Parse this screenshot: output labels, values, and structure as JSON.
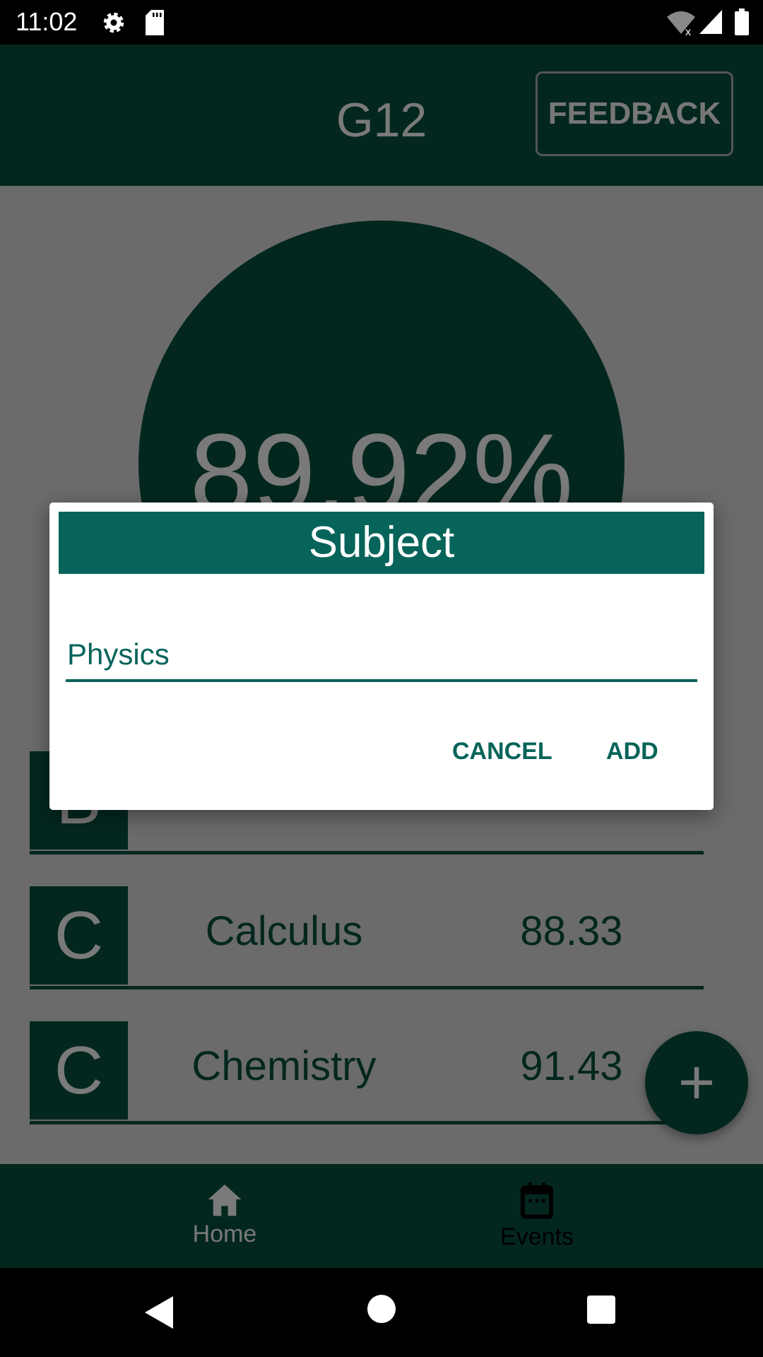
{
  "status_bar": {
    "time": "11:02",
    "icons": [
      "settings-icon",
      "sd-card-icon",
      "wifi-off-icon",
      "signal-icon",
      "battery-icon"
    ]
  },
  "app_bar": {
    "title": "G12",
    "feedback_label": "FEEDBACK"
  },
  "overall": {
    "percent": "89.92%"
  },
  "subjects": [
    {
      "grade": "B"
    },
    {
      "grade": "C",
      "name": "Calculus",
      "score": "88.33"
    },
    {
      "grade": "C",
      "name": "Chemistry",
      "score": "91.43"
    }
  ],
  "fab": {
    "icon": "plus-icon",
    "label": "+"
  },
  "bottom_nav": {
    "items": [
      {
        "label": "Home",
        "icon": "home-icon"
      },
      {
        "label": "Events",
        "icon": "calendar-icon"
      }
    ]
  },
  "dialog": {
    "title": "Subject",
    "input_value": "Physics",
    "cancel_label": "CANCEL",
    "add_label": "ADD"
  },
  "colors": {
    "primary": "#07645a",
    "primary_dimmed": "#03271f",
    "scrim_bg": "#6b6b6b"
  }
}
